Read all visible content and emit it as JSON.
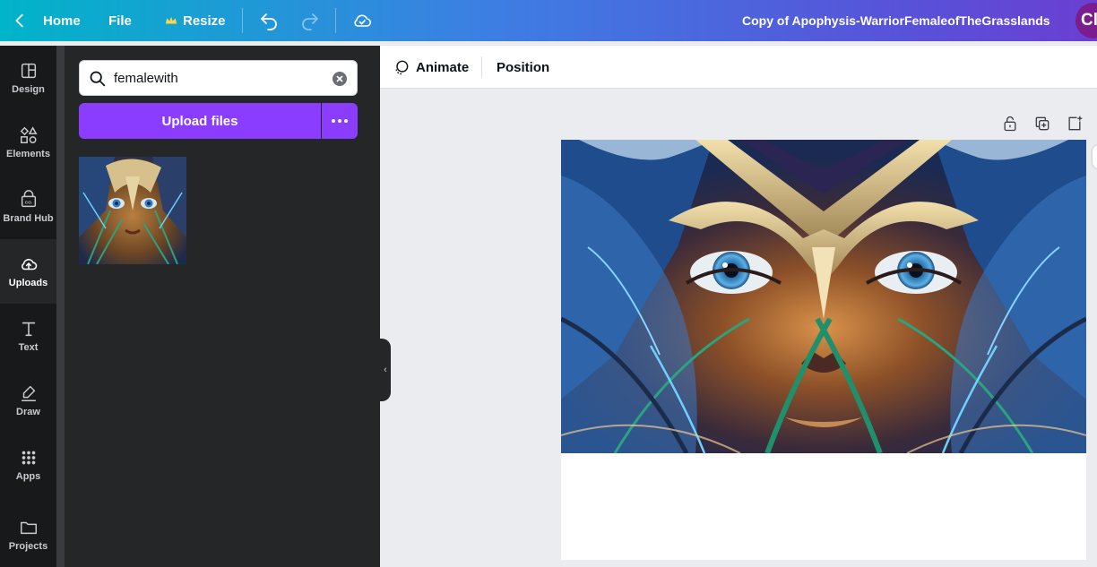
{
  "topbar": {
    "home_label": "Home",
    "file_label": "File",
    "resize_label": "Resize",
    "document_title": "Copy of Apophysis-WarriorFemaleofTheGrasslands",
    "avatar_initials": "Cl",
    "icons": [
      "chevron-left-icon",
      "crown-icon",
      "undo-icon",
      "redo-icon",
      "cloud-saved-icon"
    ],
    "gradient_colors": [
      "#01b4c9",
      "#3d7ee3",
      "#6a3fd1"
    ]
  },
  "rail": {
    "items": [
      {
        "label": "Design",
        "icon": "layout-icon"
      },
      {
        "label": "Elements",
        "icon": "shapes-icon"
      },
      {
        "label": "Brand Hub",
        "icon": "brand-icon"
      },
      {
        "label": "Uploads",
        "icon": "cloud-upload-icon",
        "active": true
      },
      {
        "label": "Text",
        "icon": "text-icon"
      },
      {
        "label": "Draw",
        "icon": "pen-icon"
      },
      {
        "label": "Apps",
        "icon": "grid-icon"
      },
      {
        "label": "Projects",
        "icon": "folder-icon"
      }
    ]
  },
  "panel": {
    "search_value": "femalewith",
    "upload_label": "Upload files",
    "accent_color": "#8b3dff",
    "results": [
      {
        "kind": "image",
        "description_icon": "image-thumbnail"
      }
    ]
  },
  "context_toolbar": {
    "animate_label": "Animate",
    "position_label": "Position"
  },
  "canvas": {
    "page_tools": [
      "lock-icon",
      "duplicate-page-icon",
      "add-page-icon"
    ]
  }
}
